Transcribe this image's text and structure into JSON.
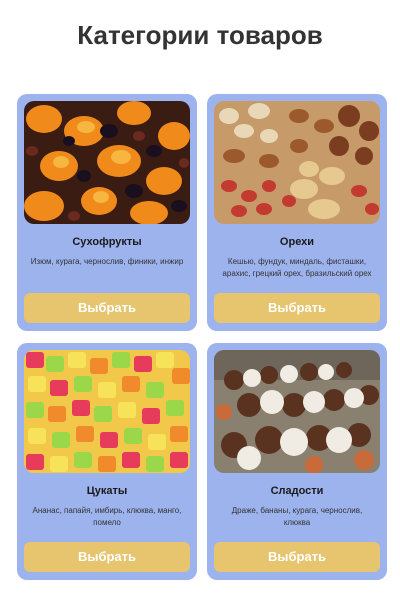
{
  "page": {
    "title": "Категории товаров"
  },
  "colors": {
    "card_bg": "#9db3ee",
    "button_bg": "#e7c46e",
    "button_text": "#ffffff",
    "title": "#333333"
  },
  "cards": [
    {
      "name": "Сухофрукты",
      "description": "Изюм, курага, чернослив, финики, инжир",
      "button_label": "Выбрать",
      "image": "dried-fruits-photo"
    },
    {
      "name": "Орехи",
      "description": "Кешью, фундук, миндаль, фисташки, арахис, грецкий орех, бразильский орех",
      "button_label": "Выбрать",
      "image": "nuts-photo"
    },
    {
      "name": "Цукаты",
      "description": "Ананас, папайя, имбирь, клюква, манго, помело",
      "button_label": "Выбрать",
      "image": "candied-fruits-photo"
    },
    {
      "name": "Сладости",
      "description": "Драже, бананы, курага, чернослив, клюква",
      "button_label": "Выбрать",
      "image": "sweets-photo"
    }
  ]
}
